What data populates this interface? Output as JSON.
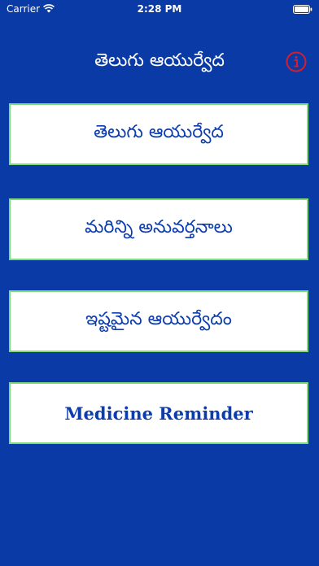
{
  "status": {
    "carrier": "Carrier",
    "time": "2:28 PM"
  },
  "header": {
    "title": "తెలుగు ఆయుర్వేద",
    "info_icon": "info-icon"
  },
  "colors": {
    "background": "#0a3aa6",
    "button_background": "#ffffff",
    "button_border": "#7ddc7a",
    "button_text": "#0b3db0",
    "info_icon": "#d41e2d"
  },
  "menu": [
    {
      "label": "తెలుగు ఆయుర్వేద"
    },
    {
      "label": "మరిన్ని అనువర్తనాలు"
    },
    {
      "label": "ఇష్టమైన ఆయుర్వేదం"
    },
    {
      "label": "Medicine Reminder"
    }
  ]
}
